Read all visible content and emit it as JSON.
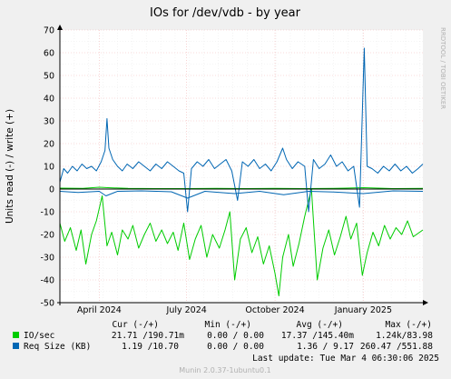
{
  "chart_data": {
    "type": "line",
    "title": "IOs for /dev/vdb - by year",
    "ylabel": "Units read (-) / write (+)",
    "side_label": "RRDTOOL / TOBI OETIKER",
    "ylim": [
      -50,
      70
    ],
    "y_ticks": [
      70,
      60,
      50,
      40,
      30,
      20,
      10,
      0,
      -10,
      -20,
      -30,
      -40,
      -50
    ],
    "x_range": [
      "2024-02-20",
      "2025-03-04"
    ],
    "x_ticks": [
      {
        "date": "2024-04-01",
        "label": "April 2024"
      },
      {
        "date": "2024-07-01",
        "label": "July 2024"
      },
      {
        "date": "2024-10-01",
        "label": "October 2024"
      },
      {
        "date": "2025-01-01",
        "label": "January 2025"
      }
    ],
    "grid": true,
    "series": [
      {
        "name": "IO/sec",
        "color": "#00cc00",
        "write_points": [
          [
            "2024-02-20",
            0.4
          ],
          [
            "2024-03-15",
            0.3
          ],
          [
            "2024-04-01",
            0.8
          ],
          [
            "2024-04-10",
            0.6
          ],
          [
            "2024-05-01",
            0.3
          ],
          [
            "2024-06-01",
            0.2
          ],
          [
            "2024-07-01",
            0.2
          ],
          [
            "2024-08-01",
            0.3
          ],
          [
            "2024-09-01",
            0.2
          ],
          [
            "2024-10-01",
            0.3
          ],
          [
            "2024-11-01",
            0.2
          ],
          [
            "2024-12-01",
            0.3
          ],
          [
            "2025-01-01",
            0.6
          ],
          [
            "2025-02-01",
            0.2
          ],
          [
            "2025-03-04",
            0.3
          ]
        ],
        "read_points": [
          [
            "2024-02-20",
            -15
          ],
          [
            "2024-02-25",
            -23
          ],
          [
            "2024-03-02",
            -17
          ],
          [
            "2024-03-08",
            -27
          ],
          [
            "2024-03-13",
            -18
          ],
          [
            "2024-03-18",
            -33
          ],
          [
            "2024-03-24",
            -20
          ],
          [
            "2024-03-29",
            -14
          ],
          [
            "2024-04-04",
            -3
          ],
          [
            "2024-04-09",
            -25
          ],
          [
            "2024-04-14",
            -19
          ],
          [
            "2024-04-20",
            -29
          ],
          [
            "2024-04-25",
            -18
          ],
          [
            "2024-05-01",
            -22
          ],
          [
            "2024-05-06",
            -16
          ],
          [
            "2024-05-12",
            -26
          ],
          [
            "2024-05-18",
            -20
          ],
          [
            "2024-05-24",
            -15
          ],
          [
            "2024-05-30",
            -23
          ],
          [
            "2024-06-05",
            -18
          ],
          [
            "2024-06-11",
            -24
          ],
          [
            "2024-06-17",
            -19
          ],
          [
            "2024-06-22",
            -27
          ],
          [
            "2024-06-28",
            -15
          ],
          [
            "2024-07-04",
            -31
          ],
          [
            "2024-07-10",
            -22
          ],
          [
            "2024-07-16",
            -16
          ],
          [
            "2024-07-22",
            -30
          ],
          [
            "2024-07-28",
            -20
          ],
          [
            "2024-08-04",
            -26
          ],
          [
            "2024-08-10",
            -18
          ],
          [
            "2024-08-15",
            -10
          ],
          [
            "2024-08-20",
            -40
          ],
          [
            "2024-08-26",
            -22
          ],
          [
            "2024-09-01",
            -17
          ],
          [
            "2024-09-07",
            -28
          ],
          [
            "2024-09-13",
            -21
          ],
          [
            "2024-09-19",
            -33
          ],
          [
            "2024-09-25",
            -25
          ],
          [
            "2024-10-01",
            -37
          ],
          [
            "2024-10-05",
            -47
          ],
          [
            "2024-10-09",
            -30
          ],
          [
            "2024-10-15",
            -20
          ],
          [
            "2024-10-20",
            -34
          ],
          [
            "2024-10-26",
            -24
          ],
          [
            "2024-11-01",
            -12
          ],
          [
            "2024-11-08",
            0
          ],
          [
            "2024-11-14",
            -40
          ],
          [
            "2024-11-20",
            -26
          ],
          [
            "2024-11-26",
            -18
          ],
          [
            "2024-12-02",
            -29
          ],
          [
            "2024-12-08",
            -21
          ],
          [
            "2024-12-14",
            -12
          ],
          [
            "2024-12-19",
            -22
          ],
          [
            "2024-12-25",
            -15
          ],
          [
            "2024-12-31",
            -38
          ],
          [
            "2025-01-05",
            -28
          ],
          [
            "2025-01-11",
            -19
          ],
          [
            "2025-01-17",
            -25
          ],
          [
            "2025-01-23",
            -16
          ],
          [
            "2025-01-29",
            -22
          ],
          [
            "2025-02-04",
            -17
          ],
          [
            "2025-02-10",
            -20
          ],
          [
            "2025-02-16",
            -14
          ],
          [
            "2025-02-22",
            -21
          ],
          [
            "2025-03-04",
            -18
          ]
        ]
      },
      {
        "name": "Req Size (KB)",
        "color": "#0066b3",
        "write_points": [
          [
            "2024-02-20",
            3
          ],
          [
            "2024-02-24",
            9
          ],
          [
            "2024-02-28",
            7
          ],
          [
            "2024-03-04",
            10
          ],
          [
            "2024-03-09",
            8
          ],
          [
            "2024-03-14",
            11
          ],
          [
            "2024-03-19",
            9
          ],
          [
            "2024-03-24",
            10
          ],
          [
            "2024-03-29",
            8
          ],
          [
            "2024-04-03",
            12
          ],
          [
            "2024-04-07",
            17
          ],
          [
            "2024-04-09",
            31
          ],
          [
            "2024-04-11",
            18
          ],
          [
            "2024-04-15",
            13
          ],
          [
            "2024-04-20",
            10
          ],
          [
            "2024-04-25",
            8
          ],
          [
            "2024-04-30",
            11
          ],
          [
            "2024-05-06",
            9
          ],
          [
            "2024-05-12",
            12
          ],
          [
            "2024-05-18",
            10
          ],
          [
            "2024-05-24",
            8
          ],
          [
            "2024-05-30",
            11
          ],
          [
            "2024-06-05",
            9
          ],
          [
            "2024-06-11",
            12
          ],
          [
            "2024-06-17",
            10
          ],
          [
            "2024-06-23",
            8
          ],
          [
            "2024-06-28",
            7
          ],
          [
            "2024-07-02",
            -10
          ],
          [
            "2024-07-06",
            9
          ],
          [
            "2024-07-12",
            12
          ],
          [
            "2024-07-18",
            10
          ],
          [
            "2024-07-24",
            13
          ],
          [
            "2024-07-30",
            9
          ],
          [
            "2024-08-05",
            11
          ],
          [
            "2024-08-11",
            13
          ],
          [
            "2024-08-17",
            8
          ],
          [
            "2024-08-23",
            -5
          ],
          [
            "2024-08-28",
            12
          ],
          [
            "2024-09-03",
            10
          ],
          [
            "2024-09-09",
            13
          ],
          [
            "2024-09-15",
            9
          ],
          [
            "2024-09-21",
            11
          ],
          [
            "2024-09-27",
            8
          ],
          [
            "2024-10-03",
            12
          ],
          [
            "2024-10-09",
            18
          ],
          [
            "2024-10-13",
            13
          ],
          [
            "2024-10-19",
            9
          ],
          [
            "2024-10-25",
            12
          ],
          [
            "2024-11-01",
            10
          ],
          [
            "2024-11-05",
            -10
          ],
          [
            "2024-11-10",
            13
          ],
          [
            "2024-11-16",
            9
          ],
          [
            "2024-11-22",
            11
          ],
          [
            "2024-11-28",
            15
          ],
          [
            "2024-12-04",
            10
          ],
          [
            "2024-12-10",
            12
          ],
          [
            "2024-12-16",
            8
          ],
          [
            "2024-12-22",
            10
          ],
          [
            "2024-12-28",
            -8
          ],
          [
            "2025-01-02",
            62
          ],
          [
            "2025-01-05",
            10
          ],
          [
            "2025-01-10",
            9
          ],
          [
            "2025-01-16",
            7
          ],
          [
            "2025-01-22",
            10
          ],
          [
            "2025-01-28",
            8
          ],
          [
            "2025-02-03",
            11
          ],
          [
            "2025-02-09",
            8
          ],
          [
            "2025-02-15",
            10
          ],
          [
            "2025-02-21",
            7
          ],
          [
            "2025-02-27",
            9
          ],
          [
            "2025-03-04",
            11
          ]
        ],
        "read_points": [
          [
            "2024-02-20",
            -1
          ],
          [
            "2024-03-10",
            -1.5
          ],
          [
            "2024-04-01",
            -1
          ],
          [
            "2024-04-08",
            -3
          ],
          [
            "2024-04-20",
            -1
          ],
          [
            "2024-05-15",
            -0.8
          ],
          [
            "2024-06-15",
            -1.2
          ],
          [
            "2024-07-02",
            -4
          ],
          [
            "2024-07-20",
            -1
          ],
          [
            "2024-08-20",
            -2
          ],
          [
            "2024-09-15",
            -1
          ],
          [
            "2024-10-10",
            -2.5
          ],
          [
            "2024-11-05",
            -1
          ],
          [
            "2024-12-01",
            -1.3
          ],
          [
            "2025-01-01",
            -2
          ],
          [
            "2025-02-01",
            -0.8
          ],
          [
            "2025-03-04",
            -1
          ]
        ]
      }
    ]
  },
  "legend": {
    "headers": [
      "Cur (-/+)",
      "Min (-/+)",
      "Avg (-/+)",
      "Max (-/+)"
    ],
    "rows": [
      {
        "name": "IO/sec",
        "color": "#00cc00",
        "cur": "21.71 /190.71m",
        "min": "0.00 /  0.00",
        "avg": "17.37 /145.40m",
        "max": "1.24k/83.98"
      },
      {
        "name": "Req Size (KB)",
        "color": "#0066b3",
        "cur": "1.19 /10.70",
        "min": "0.00 /  0.00",
        "avg": "1.36 /  9.17",
        "max": "260.47 /551.88"
      }
    ]
  },
  "last_update": "Last update: Tue Mar  4 06:30:06 2025",
  "footer": "Munin 2.0.37-1ubuntu0.1"
}
